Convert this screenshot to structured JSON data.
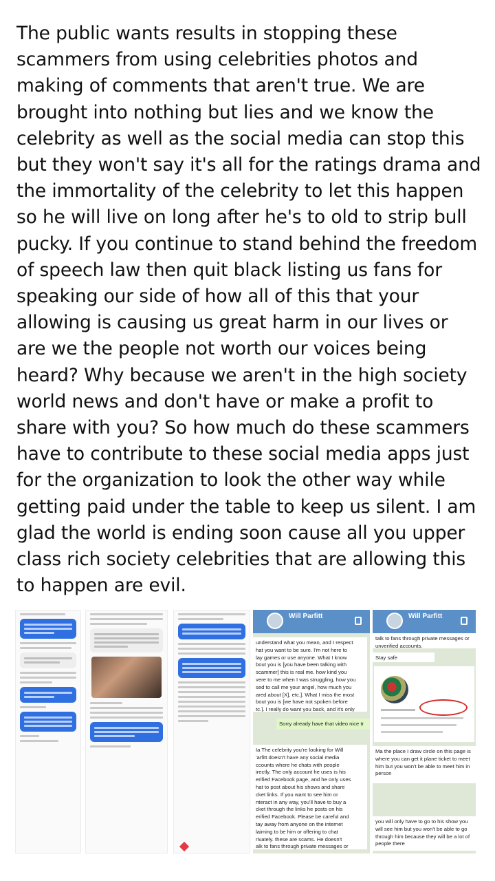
{
  "post": {
    "lines": [
      "The public wants results in stopping these",
      "scammers from using celebrities photos and",
      "making of comments that aren't true. We are",
      "brought into nothing but lies and we know the",
      "celebrity as well as the social media can stop this",
      "but they won't say it's all for the ratings drama and",
      "the immortality of the celebrity to let this happen",
      "so he will live on long after he's to old to strip bull",
      "pucky. If you continue to stand behind the freedom",
      "of speech law then quit black listing us fans for",
      "speaking our side of how all of this that your",
      "allowing is causing us great harm in our lives or",
      "are we the people not worth our voices being",
      "heard? Why because we aren't in the high society",
      "world news and don't have or make a profit to",
      "share with you? So how much do these scammers",
      "have to contribute to these social media apps just",
      "for the organization to look the other way while",
      "getting paid under the table to keep us silent. I am",
      "glad the world is ending soon cause all you upper",
      "class rich society celebrities that are allowing this",
      "to happen are evil."
    ]
  },
  "telegram_left": {
    "name": "Will Parfitt",
    "message_1": "understand what you mean, and I respect\nhat you want to be sure. I'm not here to\nlay games or use anyone. What I know\nbout you is [you have been talking with\nscammer] this is real me. how kind you\nvere to me when I was struggling, how you\nsed to call me your angel, how much you\nared about [X], etc.]. What I miss the most\nbout you is [we have not spoken before\ntc.]. I really do want you back, and it's only\nou I'm thinking about .nobody else.\"",
    "message_2": "Sorry already have that video nice tr",
    "message_3": "Ia The celebrity you're looking for  Will\n'arfitt  doesn't have any social media\nccounts where he chats with people\nirectly. The only account he uses is his\nerified Facebook page, and he only uses\nhat to post about his shows and share\ncket links. If you want to see him or\nnteract in any way, you'll have to buy a\ncket through the links he posts on his\nerified Facebook. Please be careful and\ntay away from anyone on the internet\nlaiming to be him or offering to chat\nrivately. these are scams. He doesn't\nalk to fans through private messages or\nnverified accounts."
  },
  "telegram_right": {
    "name": "Will Parfitt",
    "message_1": "talk to fans through private messages or\nunverified accounts.",
    "message_2": "Stay safe",
    "message_3": "Ma the place I draw circle on this page is\nwhere you can get it plane ticket to meet\nhim but you won't be able to meet him in\nperson",
    "message_4": "you will only have to go to his show you\nwill see him but you won't be able to go\nthrough him because they will be a lot of\npeople there"
  }
}
